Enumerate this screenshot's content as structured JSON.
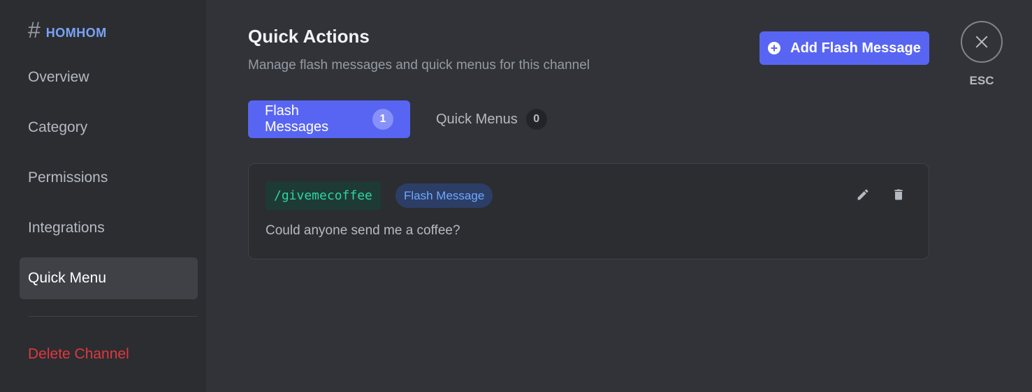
{
  "sidebar": {
    "channel_hash": "#",
    "channel_name": "HOMHOM",
    "items": [
      {
        "label": "Overview"
      },
      {
        "label": "Category"
      },
      {
        "label": "Permissions"
      },
      {
        "label": "Integrations"
      },
      {
        "label": "Quick Menu",
        "active": true
      }
    ],
    "delete_label": "Delete Channel"
  },
  "header": {
    "title": "Quick Actions",
    "subtitle": "Manage flash messages and quick menus for this channel",
    "add_button_label": "Add Flash Message",
    "esc_label": "ESC"
  },
  "tabs": [
    {
      "label": "Flash Messages",
      "count": "1",
      "active": true
    },
    {
      "label": "Quick Menus",
      "count": "0",
      "active": false
    }
  ],
  "flash_messages": [
    {
      "command": "/givemecoffee",
      "type": "Flash Message",
      "message": "Could anyone send me a coffee?"
    }
  ],
  "colors": {
    "accent": "#5865f2",
    "danger": "#e0383e",
    "channel_name": "#7aa2f7",
    "command_text": "#2dd4a3",
    "badge_text": "#6ea8ff"
  },
  "icons": {
    "add": "plus-circle-icon",
    "close": "close-icon",
    "edit": "pencil-icon",
    "delete": "trash-icon"
  }
}
